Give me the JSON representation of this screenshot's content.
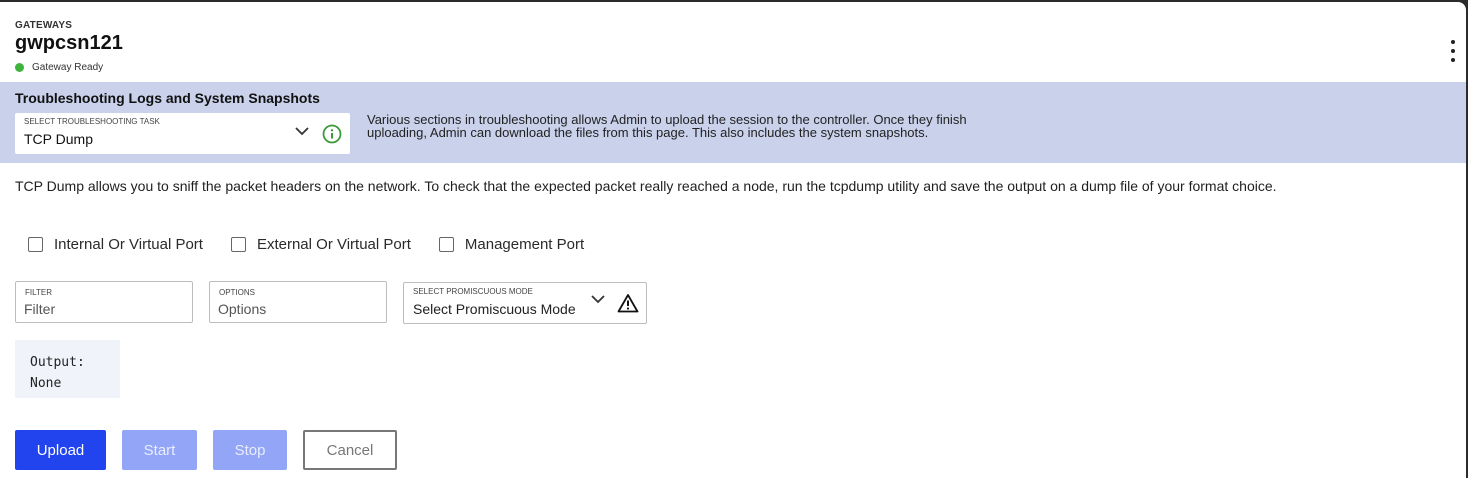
{
  "colors": {
    "band_bg": "#c9d1eb",
    "status_ready": "#3db53d",
    "info_icon": "#3a9a3a",
    "primary": "#2244ee",
    "primary_disabled": "#93a5f6"
  },
  "header": {
    "breadcrumb": "GATEWAYS",
    "title": "gwpcsn121",
    "status": "Gateway Ready",
    "menu_icon": "kebab-menu-icon"
  },
  "troubleshooting": {
    "section_title": "Troubleshooting Logs and System Snapshots",
    "task_select": {
      "label": "SELECT TROUBLESHOOTING TASK",
      "value": "TCP Dump",
      "icons": [
        "chevron-down-icon",
        "info-icon"
      ]
    },
    "description": "Various sections in troubleshooting allows Admin to upload the session to the controller. Once they finish uploading, Admin can download the files from this page. This also includes the system snapshots."
  },
  "tcpdump": {
    "intro": "TCP Dump allows you to sniff the packet headers on the network. To check that the expected packet really reached a node, run the tcpdump utility and save the output on a dump file of your format choice.",
    "ports": [
      {
        "label": "Internal Or Virtual Port",
        "checked": false
      },
      {
        "label": "External Or Virtual Port",
        "checked": false
      },
      {
        "label": "Management Port",
        "checked": false
      }
    ],
    "filter": {
      "label": "FILTER",
      "placeholder": "Filter"
    },
    "options": {
      "label": "OPTIONS",
      "placeholder": "Options"
    },
    "promiscuous": {
      "label": "SELECT PROMISCUOUS MODE",
      "value": "Select Promiscuous Mode",
      "icons": [
        "chevron-down-icon",
        "warning-icon"
      ]
    },
    "output": {
      "label": "Output:",
      "value": "None"
    }
  },
  "actions": {
    "upload": "Upload",
    "start": "Start",
    "stop": "Stop",
    "cancel": "Cancel"
  }
}
